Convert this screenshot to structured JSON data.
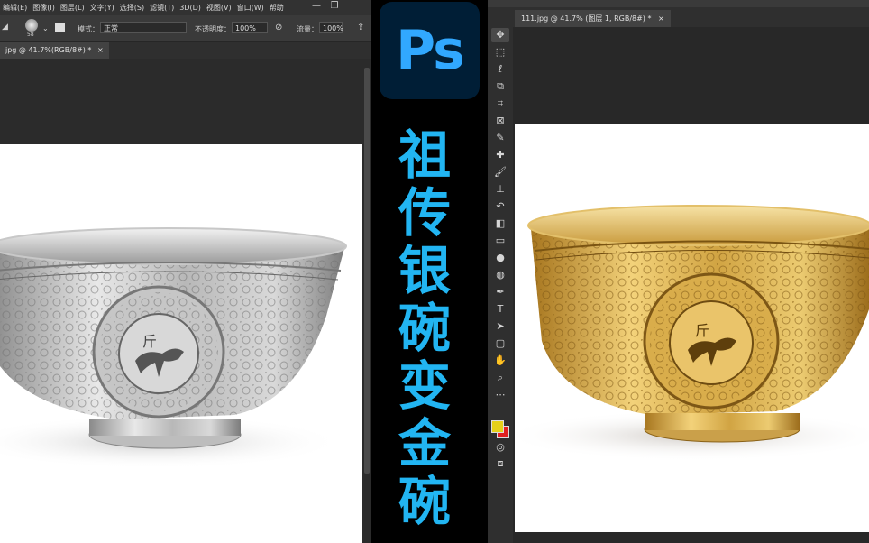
{
  "left_window": {
    "menu": [
      "编辑(E)",
      "图像(I)",
      "图层(L)",
      "文字(Y)",
      "选择(S)",
      "滤镜(T)",
      "3D(D)",
      "视图(V)",
      "窗口(W)",
      "帮助"
    ],
    "window_controls": {
      "minimize": "—",
      "restore": "❐"
    },
    "options": {
      "brush_size": "58",
      "mode_label": "模式：",
      "mode_value": "正常",
      "opacity_label": "不透明度：",
      "opacity_value": "100%",
      "flow_label": "流量：",
      "flow_value": "100%"
    },
    "doc_tab": {
      "title": "jpg @ 41.7%(RGB/8#) *",
      "close": "×"
    }
  },
  "center": {
    "logo": "Ps",
    "title_chars": [
      "祖",
      "传",
      "银",
      "碗",
      "变",
      "金",
      "碗"
    ]
  },
  "right_window": {
    "doc_tab": {
      "title": "111.jpg @ 41.7% (图层 1, RGB/8#) *",
      "close": "×"
    },
    "foreground_color": "#e6d11a",
    "background_color": "#e02020",
    "tools": [
      "move-icon",
      "marquee-icon",
      "lasso-icon",
      "object-select-icon",
      "crop-icon",
      "frame-icon",
      "eyedropper-icon",
      "healing-icon",
      "brush-icon",
      "stamp-icon",
      "history-brush-icon",
      "eraser-icon",
      "gradient-icon",
      "blur-icon",
      "dodge-icon",
      "pen-icon",
      "type-icon",
      "path-select-icon",
      "rectangle-icon",
      "hand-icon",
      "zoom-icon",
      "more-icon"
    ]
  },
  "colors": {
    "ps_blue": "#31a8ff",
    "title_blue": "#22b5f2",
    "silver": "#c0c0c0",
    "gold": "#d9b04a"
  }
}
